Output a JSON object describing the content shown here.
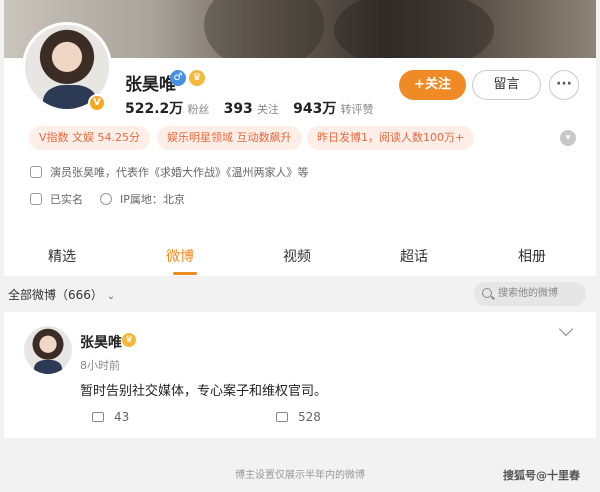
{
  "profile": {
    "name": "张昊唯",
    "followers": "522.2万",
    "followers_label": "粉丝",
    "following": "393",
    "following_label": "关注",
    "interactions": "943万",
    "interactions_label": "转评赞",
    "follow_label": "+关注",
    "message_label": "留言",
    "more_label": "···",
    "verified_letter": "V"
  },
  "tags": [
    "V指数 文娱 54.25分",
    "娱乐明星领域 互动数飙升",
    "昨日发博1，阅读人数100万+"
  ],
  "info": {
    "bio": "演员张昊唯，代表作《求婚大作战》《温州两家人》等",
    "verified_name": "已实名",
    "ip": "IP属地：北京"
  },
  "tabs": [
    "精选",
    "微博",
    "视频",
    "超话",
    "相册"
  ],
  "active_tab": "微博",
  "filter": {
    "label": "全部微博（666）",
    "search_placeholder": "搜索他的微博"
  },
  "post": {
    "author": "张昊唯",
    "time": "8小时前",
    "text": "暂时告别社交媒体，专心案子和维权官司。",
    "reposts": "43",
    "comments": "528"
  },
  "footer_note": "博主设置仅展示半年内的微博",
  "watermark": "搜狐号@十里春",
  "colors": {
    "accent": "#f08a24",
    "tag_bg": "#fdeee8",
    "tag_text": "#e8693e"
  }
}
